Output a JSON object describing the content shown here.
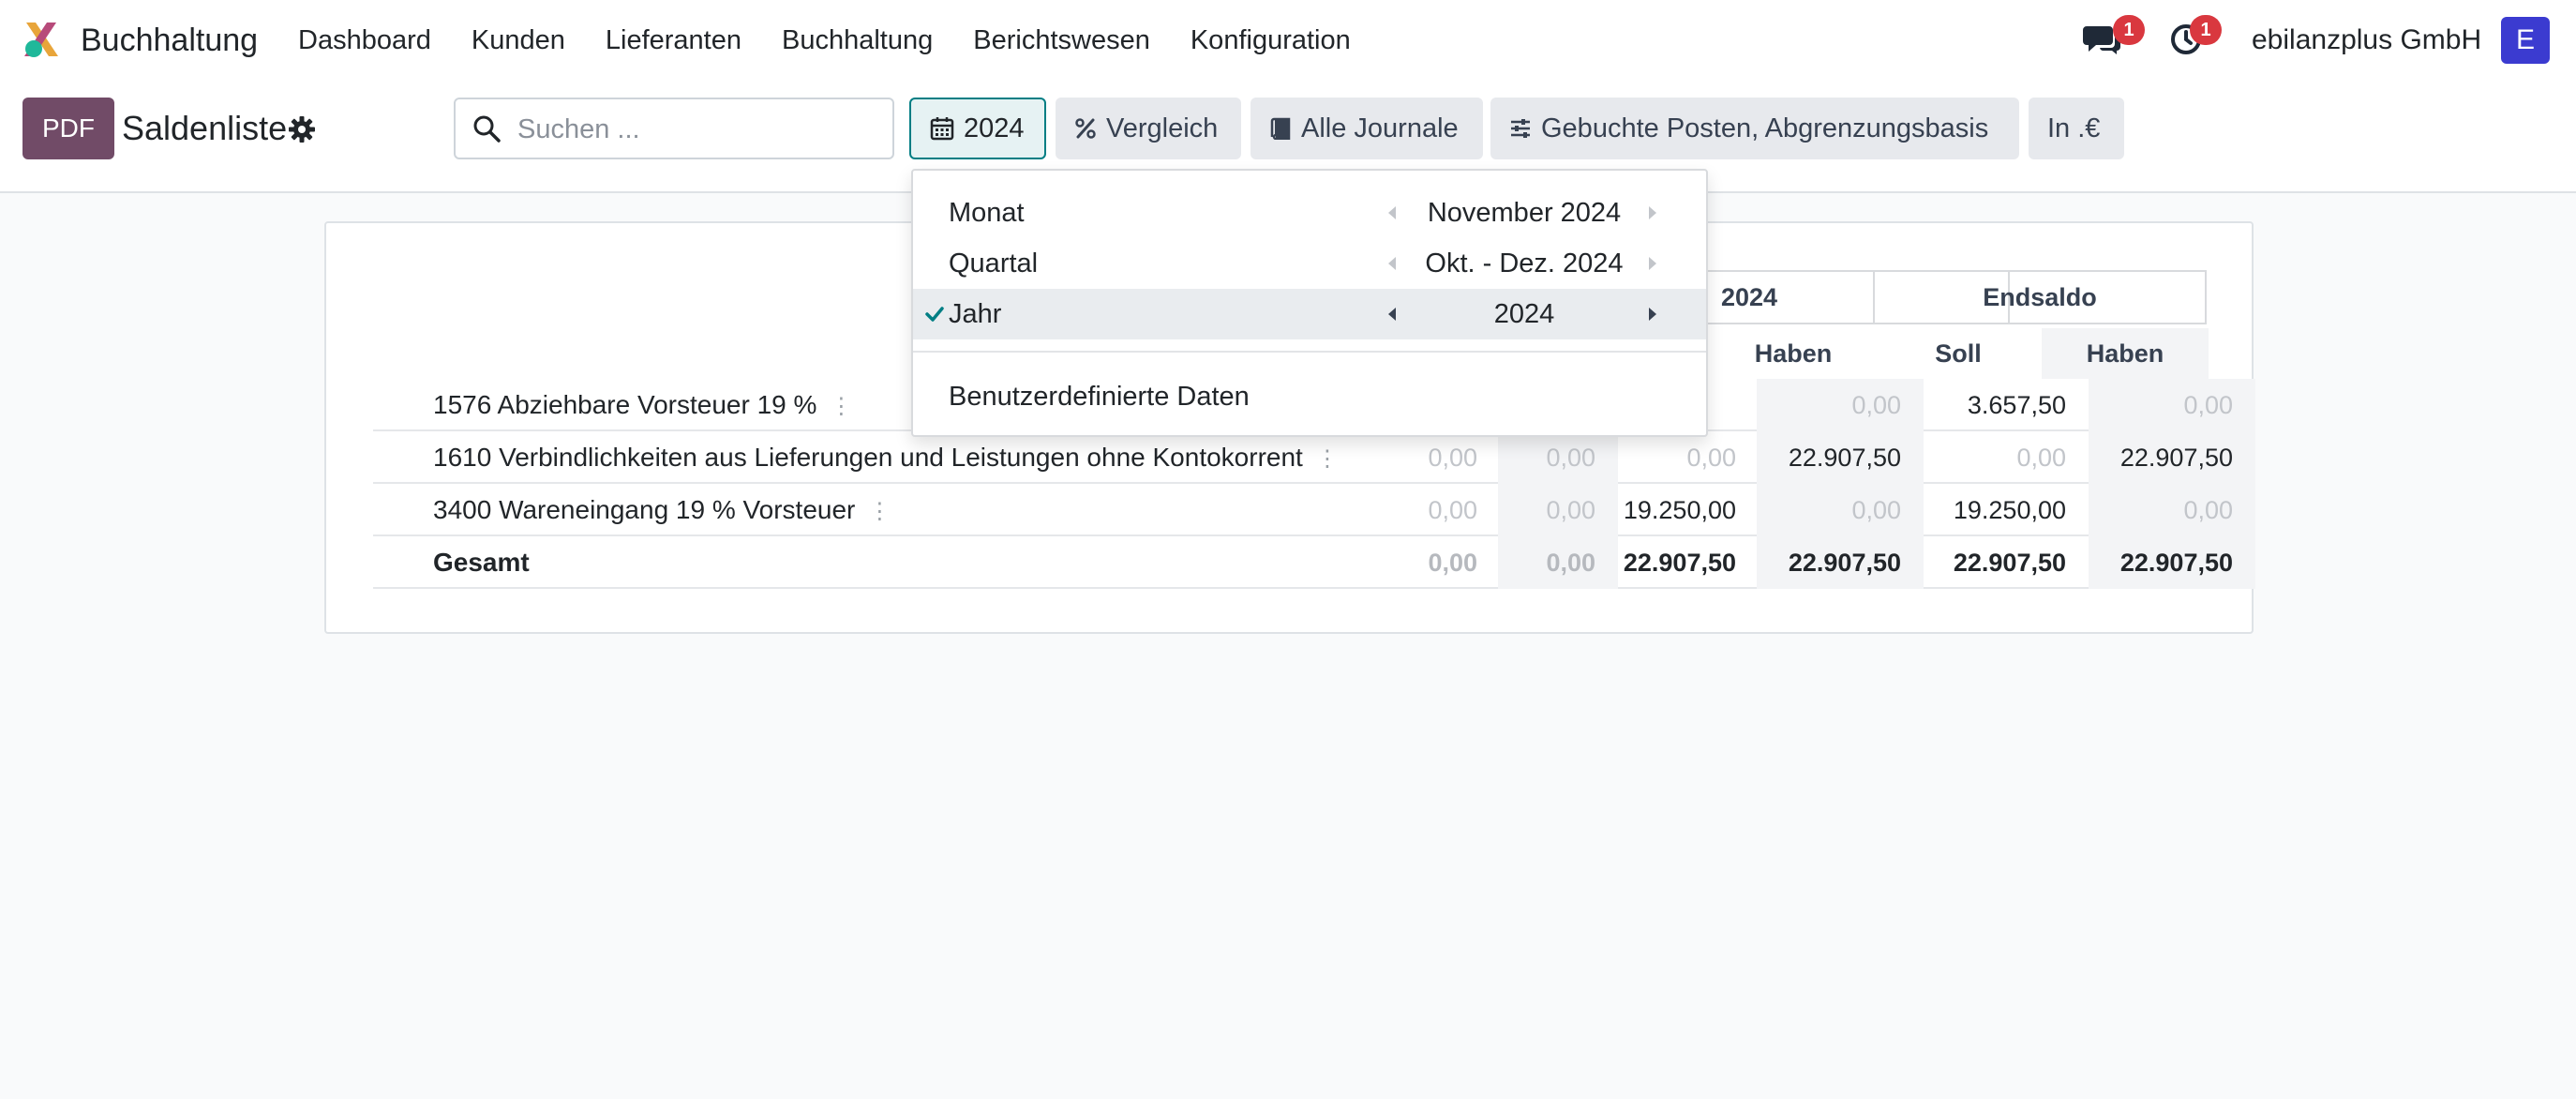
{
  "navbar": {
    "app_name": "Buchhaltung",
    "menu": [
      "Dashboard",
      "Kunden",
      "Lieferanten",
      "Buchhaltung",
      "Berichtswesen",
      "Konfiguration"
    ],
    "chat_badge": "1",
    "activity_badge": "1",
    "company": "ebilanzplus GmbH",
    "avatar_letter": "E"
  },
  "control_panel": {
    "pdf_label": "PDF",
    "title": "Saldenliste",
    "search_placeholder": "Suchen ...",
    "date_filter": "2024",
    "compare_label": "Vergleich",
    "journals_label": "Alle Journale",
    "options_label": "Gebuchte Posten, Abgrenzungsbasis",
    "currency_label": "In .€"
  },
  "date_dropdown": {
    "rows": [
      {
        "label": "Monat",
        "value": "November 2024",
        "active": false
      },
      {
        "label": "Quartal",
        "value": "Okt. - Dez. 2024",
        "active": false
      },
      {
        "label": "Jahr",
        "value": "2024",
        "active": true
      }
    ],
    "custom_label": "Benutzerdefinierte Daten"
  },
  "report": {
    "group_headers": {
      "period": "2024",
      "end": "Endsaldo"
    },
    "sub_headers": [
      "Haben",
      "Soll",
      "Haben"
    ],
    "rows": [
      {
        "label": "1576 Abziehbare Vorsteuer 19 %",
        "values": [
          "",
          "",
          "",
          "0,00",
          "3.657,50",
          "0,00"
        ]
      },
      {
        "label": "1610 Verbindlichkeiten aus Lieferungen und Leistungen ohne Kontokorrent",
        "values": [
          "0,00",
          "0,00",
          "0,00",
          "22.907,50",
          "0,00",
          "22.907,50"
        ]
      },
      {
        "label": "3400 Wareneingang 19 % Vorsteuer",
        "values": [
          "0,00",
          "0,00",
          "19.250,00",
          "0,00",
          "19.250,00",
          "0,00"
        ]
      }
    ],
    "total": {
      "label": "Gesamt",
      "values": [
        "0,00",
        "0,00",
        "22.907,50",
        "22.907,50",
        "22.907,50",
        "22.907,50"
      ]
    }
  },
  "colors": {
    "brand": "#714b67",
    "accent": "#017e84",
    "badge": "#d9383f",
    "avatar": "#3b3bd0"
  }
}
